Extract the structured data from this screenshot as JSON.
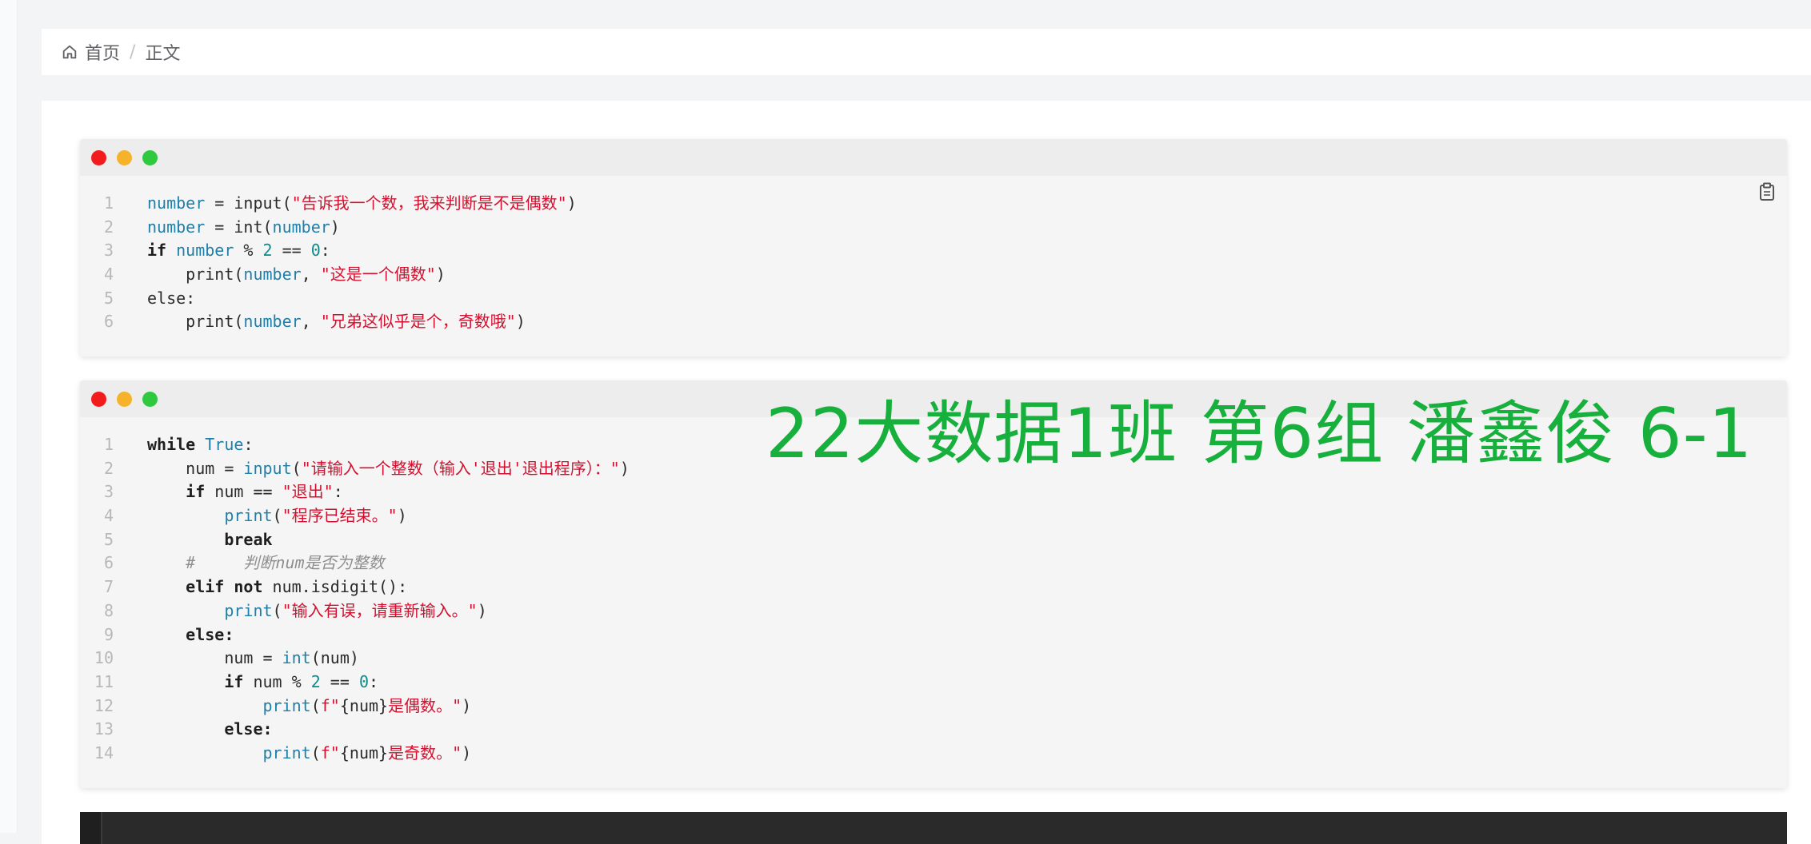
{
  "breadcrumb": {
    "home_icon": "home-icon",
    "home_label": "首页",
    "separator": "/",
    "current_label": "正文"
  },
  "watermark": {
    "text": "22大数据1班 第6组 潘鑫俊 6-1",
    "color": "#17b03c"
  },
  "colors": {
    "dot_red": "#f21c1c",
    "dot_yellow": "#f7b22b",
    "dot_green": "#2ec93f",
    "string": "#d1112f",
    "variable": "#1f7fa8",
    "number": "#0b8c8c"
  },
  "code_blocks": [
    {
      "copy_icon": "clipboard-icon",
      "lines": [
        {
          "no": "1",
          "tokens": [
            [
              "var",
              "number"
            ],
            [
              "plain",
              " = input("
            ],
            [
              "str",
              "\"告诉我一个数，我来判断是不是偶数\""
            ],
            [
              "plain",
              ")"
            ]
          ]
        },
        {
          "no": "2",
          "tokens": [
            [
              "var",
              "number"
            ],
            [
              "plain",
              " = int("
            ],
            [
              "var",
              "number"
            ],
            [
              "plain",
              ")"
            ]
          ]
        },
        {
          "no": "3",
          "tokens": [
            [
              "kw",
              "if"
            ],
            [
              "plain",
              " "
            ],
            [
              "var",
              "number"
            ],
            [
              "plain",
              " % "
            ],
            [
              "num",
              "2"
            ],
            [
              "plain",
              " == "
            ],
            [
              "num",
              "0"
            ],
            [
              "plain",
              ":"
            ]
          ]
        },
        {
          "no": "4",
          "tokens": [
            [
              "plain",
              "    print("
            ],
            [
              "var",
              "number"
            ],
            [
              "plain",
              ", "
            ],
            [
              "str",
              "\"这是一个偶数\""
            ],
            [
              "plain",
              ")"
            ]
          ]
        },
        {
          "no": "5",
          "tokens": [
            [
              "plain",
              "else:"
            ]
          ]
        },
        {
          "no": "6",
          "tokens": [
            [
              "plain",
              "    print("
            ],
            [
              "var",
              "number"
            ],
            [
              "plain",
              ", "
            ],
            [
              "str",
              "\"兄弟这似乎是个，奇数哦\""
            ],
            [
              "plain",
              ")"
            ]
          ]
        }
      ]
    },
    {
      "lines": [
        {
          "no": "1",
          "tokens": [
            [
              "kw",
              "while"
            ],
            [
              "plain",
              " "
            ],
            [
              "var",
              "True"
            ],
            [
              "plain",
              ":"
            ]
          ]
        },
        {
          "no": "2",
          "tokens": [
            [
              "plain",
              "    num = "
            ],
            [
              "fn",
              "input"
            ],
            [
              "plain",
              "("
            ],
            [
              "str",
              "\"请输入一个整数（输入'退出'退出程序）：\""
            ],
            [
              "plain",
              ")"
            ]
          ]
        },
        {
          "no": "3",
          "tokens": [
            [
              "plain",
              "    "
            ],
            [
              "kw",
              "if"
            ],
            [
              "plain",
              " num == "
            ],
            [
              "str",
              "\"退出\""
            ],
            [
              "plain",
              ":"
            ]
          ]
        },
        {
          "no": "4",
          "tokens": [
            [
              "plain",
              "        "
            ],
            [
              "fn",
              "print"
            ],
            [
              "plain",
              "("
            ],
            [
              "str",
              "\"程序已结束。\""
            ],
            [
              "plain",
              ")"
            ]
          ]
        },
        {
          "no": "5",
          "tokens": [
            [
              "plain",
              "        "
            ],
            [
              "kw",
              "break"
            ]
          ]
        },
        {
          "no": "6",
          "tokens": [
            [
              "cm",
              "    #     判断num是否为整数"
            ]
          ]
        },
        {
          "no": "7",
          "tokens": [
            [
              "plain",
              "    "
            ],
            [
              "kw",
              "elif not"
            ],
            [
              "plain",
              " num.isdigit():"
            ]
          ]
        },
        {
          "no": "8",
          "tokens": [
            [
              "plain",
              "        "
            ],
            [
              "fn",
              "print"
            ],
            [
              "plain",
              "("
            ],
            [
              "str",
              "\"输入有误，请重新输入。\""
            ],
            [
              "plain",
              ")"
            ]
          ]
        },
        {
          "no": "9",
          "tokens": [
            [
              "plain",
              "    "
            ],
            [
              "kw",
              "else:"
            ]
          ]
        },
        {
          "no": "10",
          "tokens": [
            [
              "plain",
              "        num = "
            ],
            [
              "fn",
              "int"
            ],
            [
              "plain",
              "(num)"
            ]
          ]
        },
        {
          "no": "11",
          "tokens": [
            [
              "plain",
              "        "
            ],
            [
              "kw",
              "if"
            ],
            [
              "plain",
              " num % "
            ],
            [
              "num",
              "2"
            ],
            [
              "plain",
              " == "
            ],
            [
              "num",
              "0"
            ],
            [
              "plain",
              ":"
            ]
          ]
        },
        {
          "no": "12",
          "tokens": [
            [
              "plain",
              "            "
            ],
            [
              "fn",
              "print"
            ],
            [
              "plain",
              "("
            ],
            [
              "str",
              "f\""
            ],
            [
              "plain",
              "{num}"
            ],
            [
              "str",
              "是偶数。\""
            ],
            [
              "plain",
              ")"
            ]
          ]
        },
        {
          "no": "13",
          "tokens": [
            [
              "plain",
              "        "
            ],
            [
              "kw",
              "else:"
            ]
          ]
        },
        {
          "no": "14",
          "tokens": [
            [
              "plain",
              "            "
            ],
            [
              "fn",
              "print"
            ],
            [
              "plain",
              "("
            ],
            [
              "str",
              "f\""
            ],
            [
              "plain",
              "{num}"
            ],
            [
              "str",
              "是奇数。\""
            ],
            [
              "plain",
              ")"
            ]
          ]
        }
      ]
    }
  ]
}
